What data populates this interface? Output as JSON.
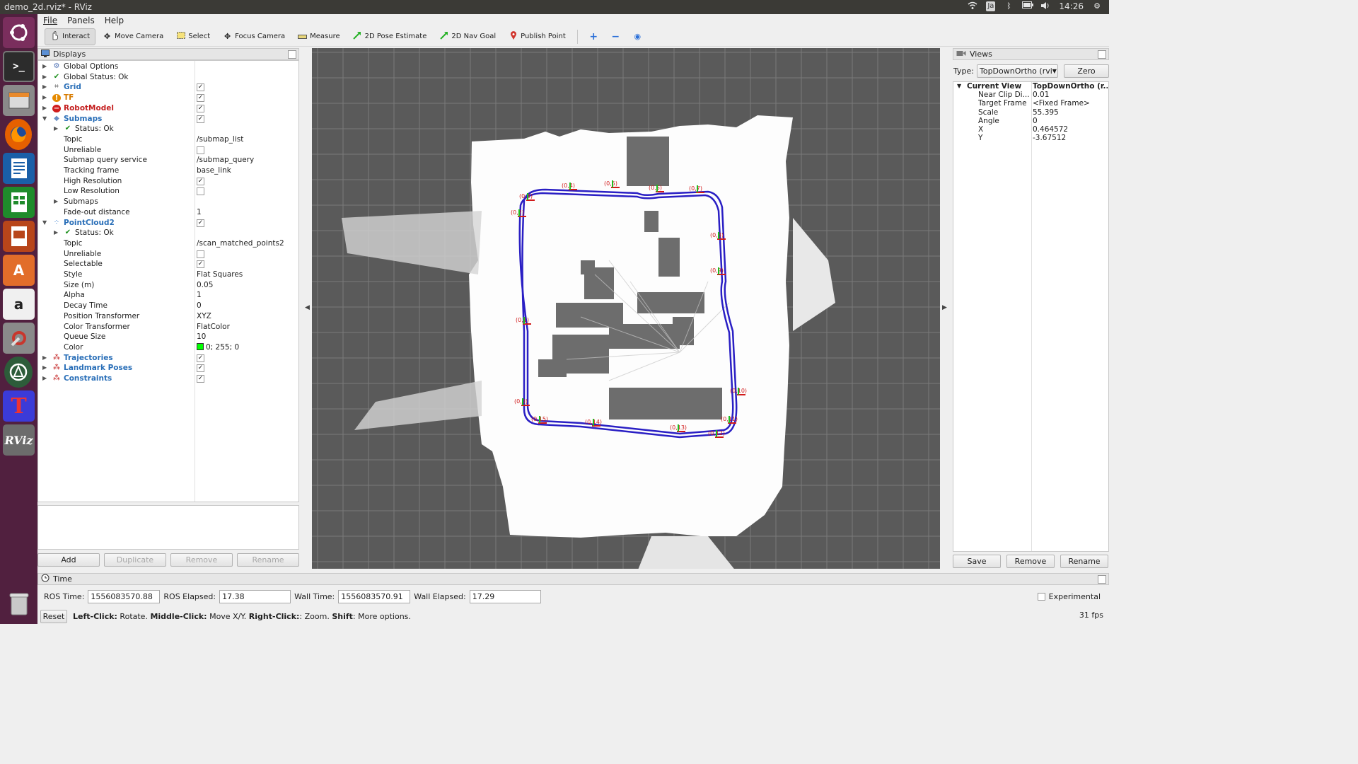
{
  "window": {
    "title": "demo_2d.rviz* - RViz"
  },
  "system_tray": {
    "keyboard": "Ja",
    "clock": "14:26"
  },
  "launcher": {
    "items": [
      "ubuntu-logo",
      "terminal",
      "files",
      "firefox",
      "writer",
      "calc",
      "impress",
      "software-center",
      "amazon",
      "system-settings",
      "updater",
      "texmaker",
      "rviz",
      "trash"
    ],
    "rviz_label": "RViz"
  },
  "menu": {
    "items": [
      "File",
      "Panels",
      "Help"
    ]
  },
  "toolbar": {
    "tools": [
      {
        "label": "Interact",
        "icon": "cursor-icon",
        "active": true
      },
      {
        "label": "Move Camera",
        "icon": "move-camera-icon"
      },
      {
        "label": "Select",
        "icon": "select-icon"
      },
      {
        "label": "Focus Camera",
        "icon": "focus-camera-icon"
      },
      {
        "label": "Measure",
        "icon": "measure-icon"
      },
      {
        "label": "2D Pose Estimate",
        "icon": "pose-estimate-arrow-icon"
      },
      {
        "label": "2D Nav Goal",
        "icon": "nav-goal-arrow-icon"
      },
      {
        "label": "Publish Point",
        "icon": "publish-point-pin-icon"
      }
    ]
  },
  "displays": {
    "title": "Displays",
    "rows": [
      {
        "label": "Global Options",
        "icon": "gear-icon",
        "expand": "collapsed",
        "indent": 0
      },
      {
        "label": "Global Status: Ok",
        "icon": "check-icon",
        "expand": "collapsed",
        "indent": 0
      },
      {
        "label": "Grid",
        "icon": "grid-icon",
        "expand": "collapsed",
        "indent": 0,
        "style": "blue",
        "checkbox": true
      },
      {
        "label": "TF",
        "icon": "warning-icon",
        "expand": "collapsed",
        "indent": 0,
        "style": "orange",
        "checkbox": true
      },
      {
        "label": "RobotModel",
        "icon": "error-icon",
        "expand": "collapsed",
        "indent": 0,
        "style": "red",
        "checkbox": true
      },
      {
        "label": "Submaps",
        "icon": "submaps-icon",
        "expand": "expanded",
        "indent": 0,
        "style": "blue",
        "checkbox": true
      },
      {
        "label": "Status: Ok",
        "icon": "check-icon",
        "expand": "collapsed",
        "indent": 1
      },
      {
        "label": "Topic",
        "indent": 1,
        "value": "/submap_list"
      },
      {
        "label": "Unreliable",
        "indent": 1,
        "checkbox": false
      },
      {
        "label": "Submap query service",
        "indent": 1,
        "value": "/submap_query"
      },
      {
        "label": "Tracking frame",
        "indent": 1,
        "value": "base_link"
      },
      {
        "label": "High Resolution",
        "indent": 1,
        "checkbox": true
      },
      {
        "label": "Low Resolution",
        "indent": 1,
        "checkbox": false
      },
      {
        "label": "Submaps",
        "indent": 1,
        "expand": "collapsed"
      },
      {
        "label": "Fade-out distance",
        "indent": 1,
        "value": "1"
      },
      {
        "label": "PointCloud2",
        "icon": "pointcloud-icon",
        "expand": "expanded",
        "indent": 0,
        "style": "blue",
        "checkbox": true
      },
      {
        "label": "Status: Ok",
        "icon": "check-icon",
        "expand": "collapsed",
        "indent": 1
      },
      {
        "label": "Topic",
        "indent": 1,
        "value": "/scan_matched_points2"
      },
      {
        "label": "Unreliable",
        "indent": 1,
        "checkbox": false
      },
      {
        "label": "Selectable",
        "indent": 1,
        "checkbox": true
      },
      {
        "label": "Style",
        "indent": 1,
        "value": "Flat Squares"
      },
      {
        "label": "Size (m)",
        "indent": 1,
        "value": "0.05"
      },
      {
        "label": "Alpha",
        "indent": 1,
        "value": "1"
      },
      {
        "label": "Decay Time",
        "indent": 1,
        "value": "0"
      },
      {
        "label": "Position Transformer",
        "indent": 1,
        "value": "XYZ"
      },
      {
        "label": "Color Transformer",
        "indent": 1,
        "value": "FlatColor"
      },
      {
        "label": "Queue Size",
        "indent": 1,
        "value": "10"
      },
      {
        "label": "Color",
        "indent": 1,
        "value": "0; 255; 0",
        "swatch": "#00ff00"
      },
      {
        "label": "Trajectories",
        "icon": "markers-icon",
        "expand": "collapsed",
        "indent": 0,
        "style": "blue",
        "checkbox": true
      },
      {
        "label": "Landmark Poses",
        "icon": "markers-icon",
        "expand": "collapsed",
        "indent": 0,
        "style": "blue",
        "checkbox": true
      },
      {
        "label": "Constraints",
        "icon": "markers-icon",
        "expand": "collapsed",
        "indent": 0,
        "style": "blue",
        "checkbox": true
      }
    ],
    "buttons": [
      "Add",
      "Duplicate",
      "Remove",
      "Rename"
    ]
  },
  "viewport": {
    "background": "#5a5a5a",
    "trajectory_color": "#2a1fc4",
    "landmark_labels": [
      "(0,0)",
      "(0,1)",
      "(0,2)",
      "(0,3)",
      "(0,4)",
      "(0,5)",
      "(0,6)",
      "(0,7)",
      "(0,8)",
      "(0,9)",
      "(0,10)",
      "(0,11)",
      "(0,12)",
      "(0,13)",
      "(0,14)",
      "(0,15)"
    ]
  },
  "views": {
    "title": "Views",
    "type_label": "Type:",
    "type_value": "TopDownOrtho (rvi",
    "zero_label": "Zero",
    "current_view": {
      "label": "Current View",
      "value": "TopDownOrtho (r..."
    },
    "rows": [
      {
        "label": "Near Clip Di...",
        "value": "0.01"
      },
      {
        "label": "Target Frame",
        "value": "<Fixed Frame>"
      },
      {
        "label": "Scale",
        "value": "55.395"
      },
      {
        "label": "Angle",
        "value": "0"
      },
      {
        "label": "X",
        "value": "0.464572"
      },
      {
        "label": "Y",
        "value": "-3.67512"
      }
    ],
    "buttons": [
      "Save",
      "Remove",
      "Rename"
    ]
  },
  "time": {
    "title": "Time",
    "ros_time_label": "ROS Time:",
    "ros_time": "1556083570.88",
    "ros_elapsed_label": "ROS Elapsed:",
    "ros_elapsed": "17.38",
    "wall_time_label": "Wall Time:",
    "wall_time": "1556083570.91",
    "wall_elapsed_label": "Wall Elapsed:",
    "wall_elapsed": "17.29",
    "experimental_label": "Experimental"
  },
  "status": {
    "reset": "Reset",
    "hint_parts": [
      {
        "b": "Left-Click:",
        "t": " Rotate. "
      },
      {
        "b": "Middle-Click:",
        "t": " Move X/Y. "
      },
      {
        "b": "Right-Click:",
        "t": ": Zoom. "
      },
      {
        "b": "Shift",
        "t": ": More options."
      }
    ],
    "fps": "31 fps"
  }
}
